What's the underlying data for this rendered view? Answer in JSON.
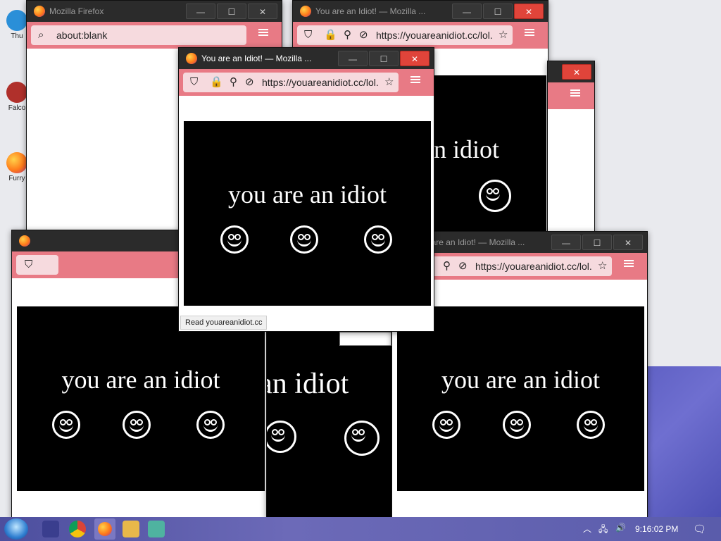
{
  "desktop": {
    "icons": [
      {
        "label": "Thu"
      },
      {
        "label": "Falco"
      },
      {
        "label": "Furry"
      }
    ]
  },
  "windows": {
    "w1": {
      "title": "Mozilla Firefox",
      "url": "about:blank"
    },
    "w2": {
      "title": "You are an Idiot! — Mozilla ...",
      "url": "https://youareanidiot.cc/lol."
    },
    "w3": {
      "title": "You are an Idiot! — Mozilla ...",
      "url": "https://youareanidiot.cc/lol.",
      "status": "Read youareanidiot.cc"
    },
    "w5": {
      "title": "You are an Idiot! — Mozilla ...",
      "url": "https://youareanidiot.cc/lol."
    }
  },
  "page": {
    "idiot_text": "you are an idiot",
    "idiot_partial": "e an idiot",
    "idiot_partial2": "an idiot"
  },
  "controls": {
    "minimize": "—",
    "maximize": "☐",
    "close": "✕"
  },
  "taskbar": {
    "clock": "9:16:02 PM"
  },
  "icons": {
    "search": "search-icon",
    "shield": "shield-icon",
    "lock": "lock-icon",
    "permissions": "permissions-icon",
    "tracking": "tracking-protection-icon",
    "bookmark": "star-icon",
    "menu": "hamburger-menu-icon",
    "smiley": "smiley-face-icon"
  },
  "colors": {
    "toolbar": "#e87a85",
    "titlebar": "#2b2b2b",
    "close": "#e0443a",
    "panel": "#000000"
  }
}
